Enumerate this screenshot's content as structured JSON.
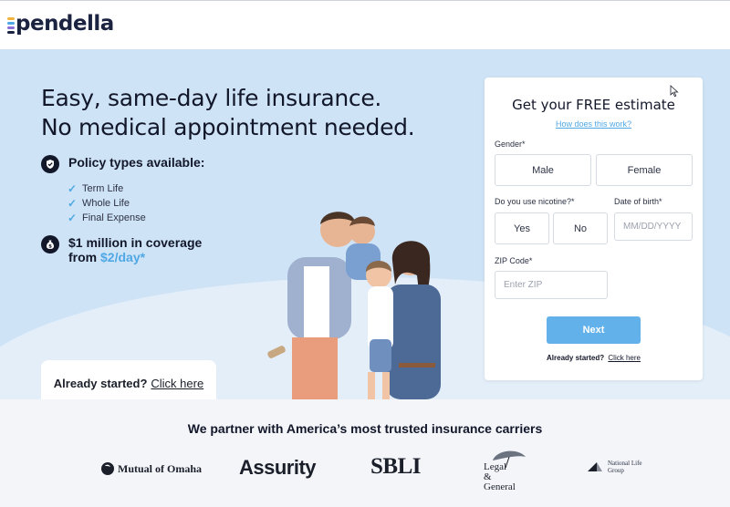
{
  "brand": {
    "name": "pendella",
    "mark_colors": [
      "#f2b33d",
      "#4fa8e6",
      "#8a6fd6",
      "#1b2340"
    ]
  },
  "hero": {
    "headline_line1": "Easy, same-day life insurance.",
    "headline_line2": "No medical appointment needed.",
    "policy_heading": "Policy types available:",
    "policy_types": [
      "Term Life",
      "Whole Life",
      "Final Expense"
    ],
    "coverage_line1": "$1 million in coverage",
    "coverage_from": "from",
    "coverage_price": "$2/day*",
    "already_started": "Already started?",
    "click_here": "Click here"
  },
  "form": {
    "title": "Get your FREE estimate",
    "how_link": "How does this work?",
    "gender_label": "Gender*",
    "gender_options": [
      "Male",
      "Female"
    ],
    "nicotine_label": "Do you use nicotine?*",
    "nicotine_options": [
      "Yes",
      "No"
    ],
    "dob_label": "Date of birth*",
    "dob_placeholder": "MM/DD/YYYY",
    "zip_label": "ZIP Code*",
    "zip_placeholder": "Enter ZIP",
    "next_label": "Next",
    "already_started": "Already started?",
    "click_here": "Click here"
  },
  "partners": {
    "title": "We partner with America’s most trusted insurance carriers",
    "carriers": {
      "mutual": "Mutual of Omaha",
      "assurity": "Assurity",
      "sbli": "SBLI",
      "legal_line1": "Legal",
      "legal_line2": "& ",
      "legal_line3": "General",
      "national_line1": "National Life",
      "national_line2": "Group"
    }
  },
  "colors": {
    "accent": "#4fa8e6",
    "button": "#63b1ea",
    "hero_bg": "#cfe3f6",
    "ink": "#12172a"
  }
}
